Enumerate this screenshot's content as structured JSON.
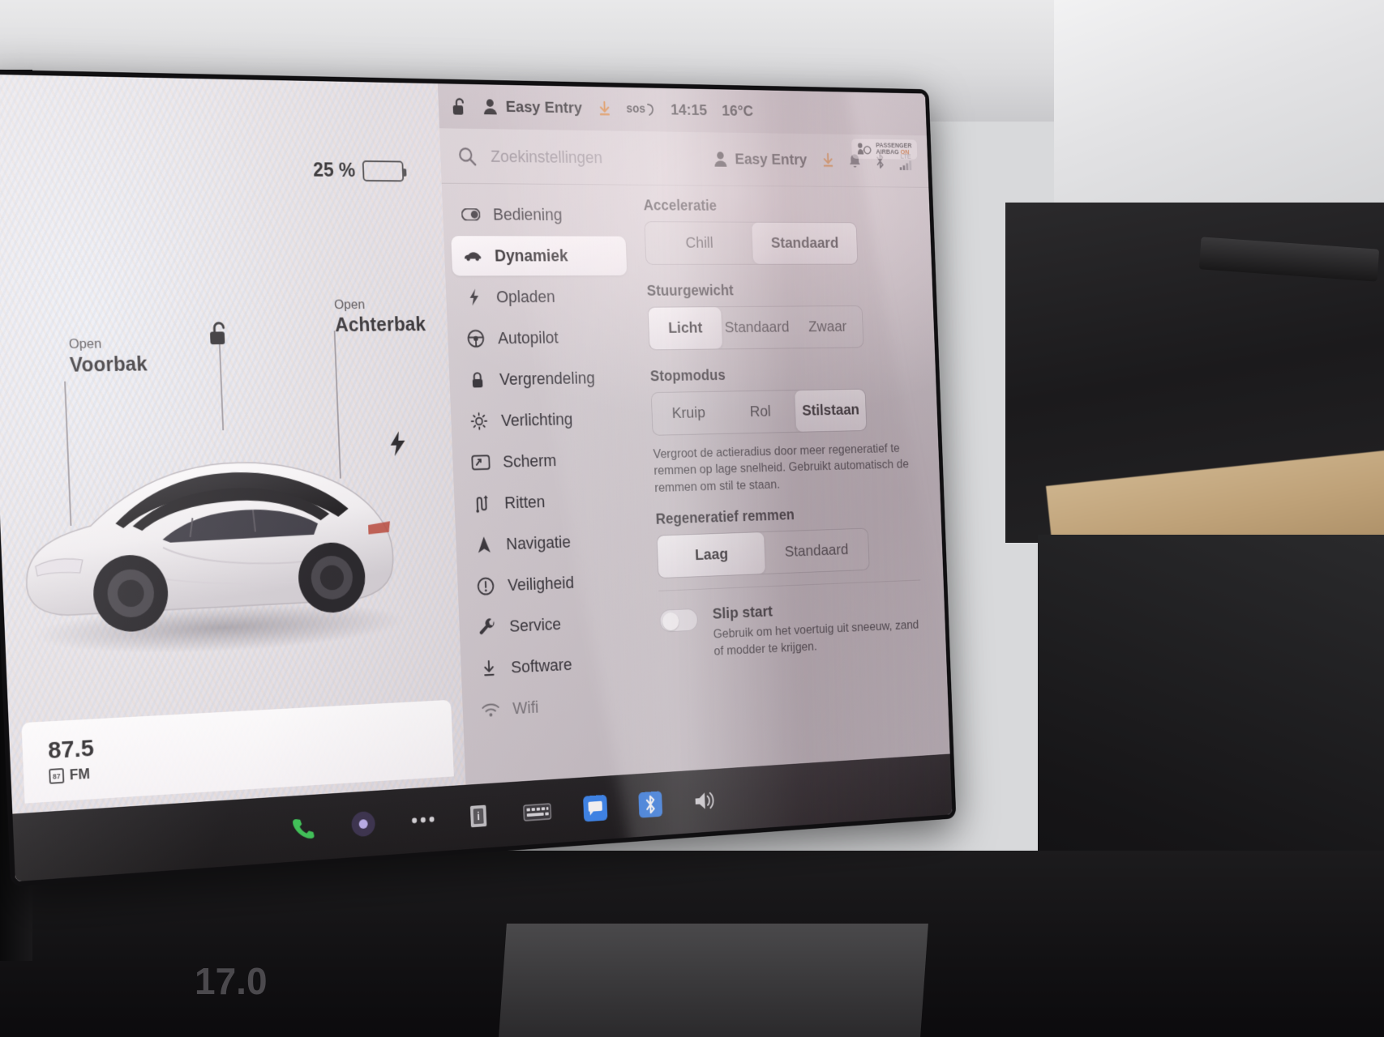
{
  "left_pane": {
    "battery_percent": "25 %",
    "battery_icon": "battery-icon",
    "front_trunk": {
      "action": "Open",
      "name": "Voorbak"
    },
    "rear_trunk": {
      "action": "Open",
      "name": "Achterbak"
    },
    "lock_icon": "unlocked-padlock-icon",
    "charge_port_icon": "charge-bolt-icon",
    "car_icon": "tesla-model-3-render",
    "media": {
      "frequency": "87.5",
      "band": "FM",
      "band_badge": "87",
      "controls": [
        {
          "name": "stop-button",
          "icon": "stop-icon"
        },
        {
          "name": "next-track-button",
          "icon": "next-track-icon"
        },
        {
          "name": "favorite-button",
          "icon": "star-icon"
        },
        {
          "name": "equalizer-button",
          "icon": "sliders-icon"
        },
        {
          "name": "media-search-button",
          "icon": "search-icon"
        }
      ],
      "page_dots": 3,
      "active_dot": 1
    },
    "back_arrow_icon": "left-arrow-icon"
  },
  "status_bar": {
    "lock_icon": "unlocked-padlock-icon",
    "profile_icon": "person-icon",
    "profile_name": "Easy Entry",
    "download_icon": "software-download-icon",
    "sos_label": "sos",
    "time": "14:15",
    "temperature": "16°C"
  },
  "search": {
    "icon": "search-icon",
    "placeholder": "Zoekinstellingen",
    "value": "",
    "profile_icon": "person-icon",
    "profile_name": "Easy Entry",
    "status_icons": [
      "software-download-icon",
      "bell-icon",
      "bluetooth-icon",
      "lte-signal-icon"
    ],
    "lte_label": "LTE"
  },
  "airbag_indicator": {
    "line1": "PASSENGER",
    "line2": "AIRBAG",
    "status": "ON",
    "icon": "passenger-airbag-icon"
  },
  "nav": {
    "items": [
      {
        "label": "Bediening",
        "icon": "toggle-switch-icon",
        "active": false
      },
      {
        "label": "Dynamiek",
        "icon": "car-icon",
        "active": true
      },
      {
        "label": "Opladen",
        "icon": "bolt-icon",
        "active": false
      },
      {
        "label": "Autopilot",
        "icon": "steering-wheel-icon",
        "active": false
      },
      {
        "label": "Vergrendeling",
        "icon": "lock-icon",
        "active": false
      },
      {
        "label": "Verlichting",
        "icon": "brightness-icon",
        "active": false
      },
      {
        "label": "Scherm",
        "icon": "display-icon",
        "active": false
      },
      {
        "label": "Ritten",
        "icon": "trips-icon",
        "active": false
      },
      {
        "label": "Navigatie",
        "icon": "navigation-arrow-icon",
        "active": false
      },
      {
        "label": "Veiligheid",
        "icon": "alert-circle-icon",
        "active": false
      },
      {
        "label": "Service",
        "icon": "wrench-icon",
        "active": false
      },
      {
        "label": "Software",
        "icon": "download-icon",
        "active": false
      },
      {
        "label": "Wifi",
        "icon": "wifi-icon",
        "active": false
      }
    ]
  },
  "detail": {
    "acceleration": {
      "title": "Acceleratie",
      "options": [
        "Chill",
        "Standaard"
      ],
      "selected": "Standaard"
    },
    "steering": {
      "title": "Stuurgewicht",
      "options": [
        "Licht",
        "Standaard",
        "Zwaar"
      ],
      "selected": "Licht"
    },
    "stopping_mode": {
      "title": "Stopmodus",
      "options": [
        "Kruip",
        "Rol",
        "Stilstaan"
      ],
      "selected": "Stilstaan",
      "description": "Vergroot de actieradius door meer regeneratief te remmen op lage snelheid. Gebruikt automatisch de remmen om stil te staan."
    },
    "regenerative_braking": {
      "title": "Regeneratief remmen",
      "options": [
        "Laag",
        "Standaard"
      ],
      "selected": "Laag"
    },
    "slip_start": {
      "label": "Slip start",
      "description": "Gebruik om het voertuig uit sneeuw, zand of modder te krijgen.",
      "enabled": false
    }
  },
  "taskbar": {
    "items": [
      {
        "name": "phone-button",
        "icon": "phone-icon",
        "color": "#2fbf4a"
      },
      {
        "name": "voice-button",
        "icon": "microphone-dot-icon",
        "color": "#6b5ad8"
      },
      {
        "name": "more-apps-button",
        "icon": "ellipsis-icon",
        "color": "#cfcfd2"
      },
      {
        "name": "info-button",
        "icon": "info-card-icon",
        "color": "#cfcfd2"
      },
      {
        "name": "keyboard-button",
        "icon": "keyboard-icon",
        "color": "#cfcfd2"
      },
      {
        "name": "messages-button",
        "icon": "message-icon",
        "color": "#2d7ff0"
      },
      {
        "name": "bluetooth-button",
        "icon": "bluetooth-icon",
        "color": "#1f6fe0"
      },
      {
        "name": "volume-button",
        "icon": "speaker-icon",
        "color": "#cfcfd2"
      }
    ]
  },
  "hvac": {
    "temperature": "17.0"
  },
  "colors": {
    "accent_orange": "#d2731f",
    "accent_blue": "#2d7ff0",
    "panel_bg": "#cdc6cb",
    "selected_bg": "#fbf9fb"
  }
}
